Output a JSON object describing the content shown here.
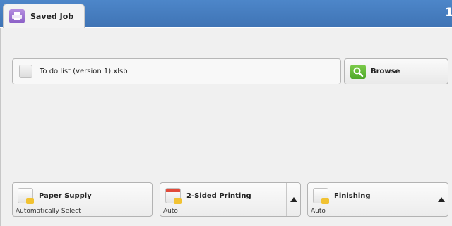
{
  "tab": {
    "label": "Saved Job",
    "icon": "printer-icon"
  },
  "corner": {
    "text": "1"
  },
  "file": {
    "name": "To do list (version 1).xlsb",
    "icon": "file-icon"
  },
  "browse": {
    "label": "Browse",
    "icon": "search-icon"
  },
  "bottom": {
    "paper_supply": {
      "label": "Paper Supply",
      "value": "Automatically Select",
      "icon": "paper-tray-icon"
    },
    "two_sided": {
      "label": "2-Sided Printing",
      "value": "Auto",
      "icon": "duplex-icon"
    },
    "finishing": {
      "label": "Finishing",
      "value": "Auto",
      "icon": "staple-icon"
    }
  },
  "colors": {
    "header": "#4d86c9",
    "tab_icon": "#9b6fd6",
    "browse_icon": "#5cb335"
  }
}
